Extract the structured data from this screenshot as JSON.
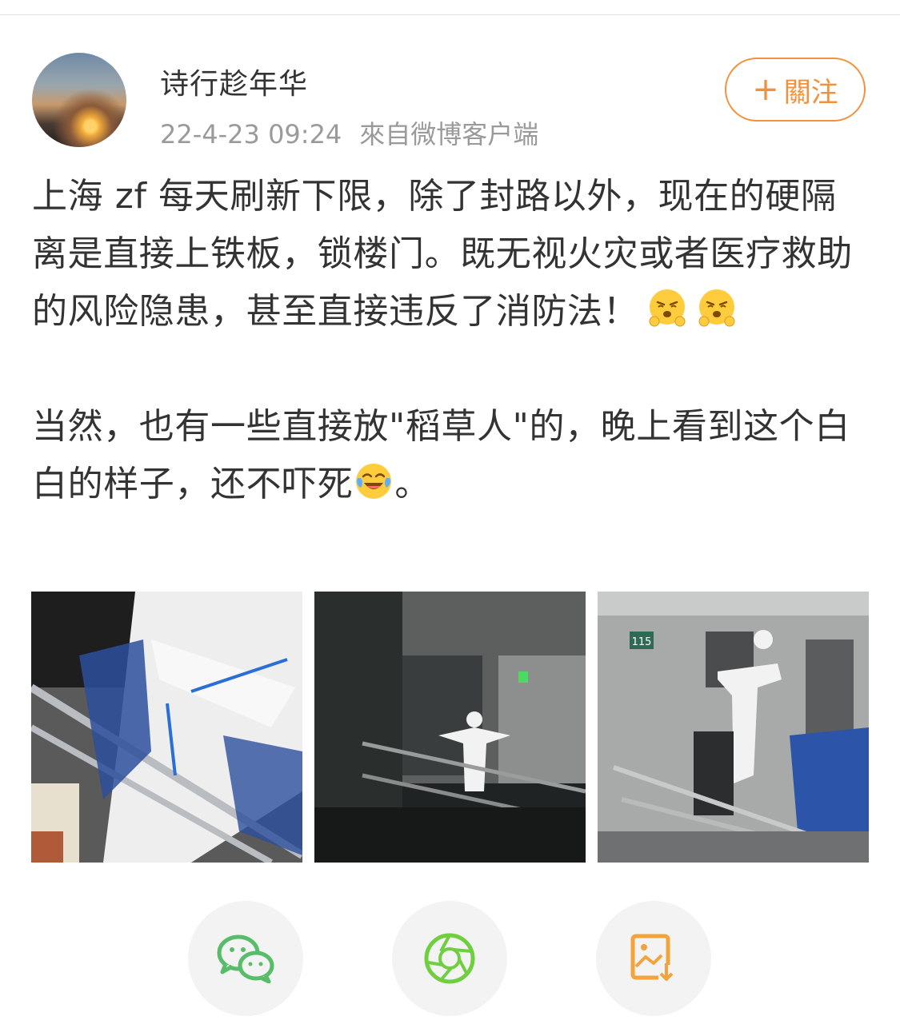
{
  "user": {
    "name": "诗行趁年华",
    "timestamp": "22-4-23 09:24",
    "source": "來自微博客户端"
  },
  "follow_button": {
    "label": "關注"
  },
  "post": {
    "paragraph1": "上海 zf 每天刷新下限，除了封路以外，现在的硬隔离是直接上铁板，锁楼门。既无视火灾或者医疗救助的风险隐患，甚至直接违反了消防法！",
    "paragraph2a": "当然，也有一些直接放\"稻草人\"的，晚上看到这个白白的样子，还不吓死",
    "paragraph2b": "。"
  },
  "photos": [
    {
      "name": "photo-hazmat-figure-railing"
    },
    {
      "name": "photo-hazmat-figure-night"
    },
    {
      "name": "photo-hazmat-figure-building-115"
    }
  ],
  "share_actions": [
    {
      "icon": "wechat-icon",
      "color": "#57bd6a"
    },
    {
      "icon": "moments-icon",
      "color": "#6fcf3f"
    },
    {
      "icon": "save-image-icon",
      "color": "#f3a33b"
    }
  ]
}
